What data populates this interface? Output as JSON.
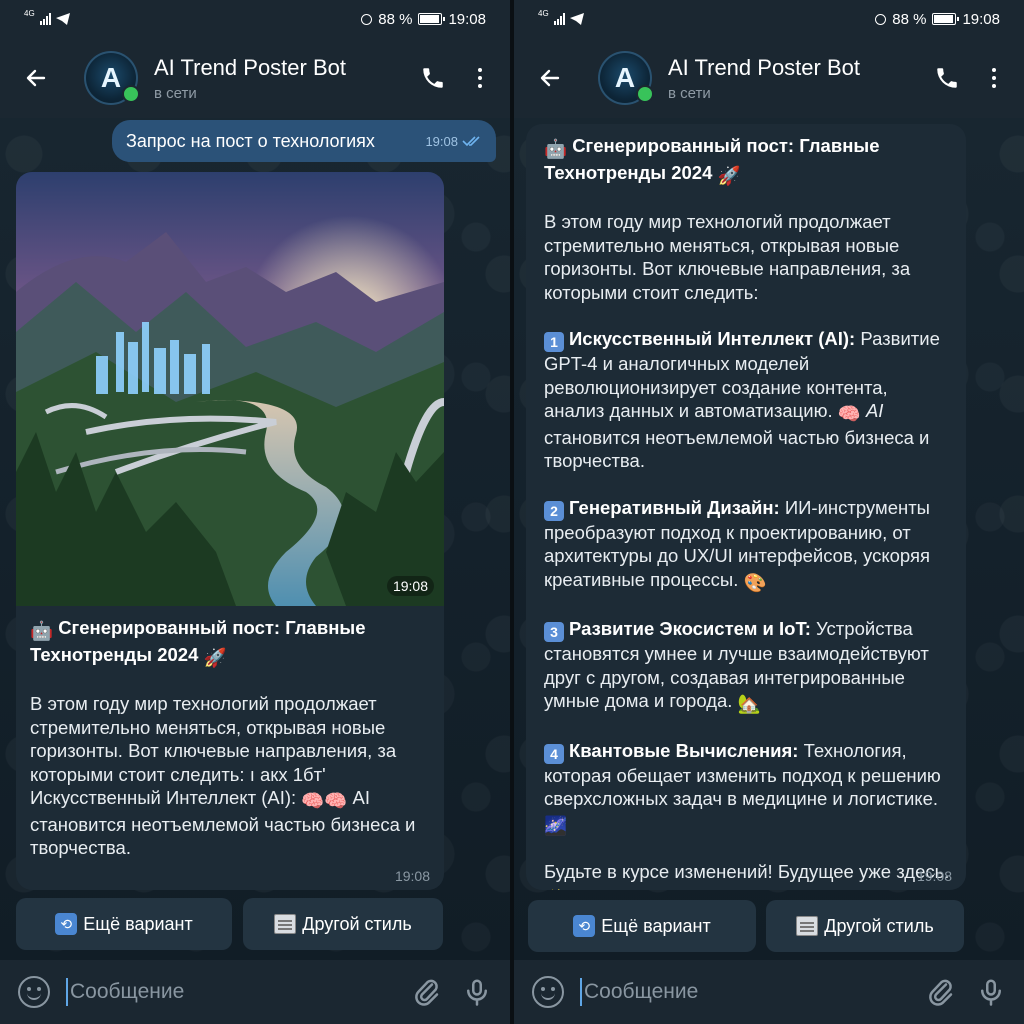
{
  "status_bar": {
    "network": "4G",
    "battery": "88 %",
    "battery_level": 0.88,
    "time": "19:08"
  },
  "header": {
    "title": "AI Trend Poster Bot",
    "status": "в сети",
    "avatar_letter": "A"
  },
  "left": {
    "outgoing": {
      "text": "Запрос на пост о технологиях",
      "time": "19:08"
    },
    "photo_time": "19:08",
    "post_title_line1": "Сгенерированный пост: Главные",
    "post_title_line2": "Технотренды 2024",
    "body": "В этом году мир технологий продолжает стремительно меняться, открывая новые горизонты. Вот ключевые направления, за которыми стоит следить: ı акх 1бт' Искусственный Интеллект (AI):",
    "body_tail": "AI становится неотъемлемой частью бизнеса и творчества.",
    "time": "19:08"
  },
  "right": {
    "post_title_line1": "Сгенерированный пост: Главные",
    "post_title_line2": "Технотренды 2024",
    "intro": "В этом году мир технологий продолжает стремительно меняться, открывая новые горизонты. Вот ключевые направления, за которыми стоит следить:",
    "items": [
      {
        "num": "1",
        "title": "Искусственный Интеллект (AI):",
        "text": "Развитие GPT-4 и аналогичных моделей революционизирует создание контента, анализ данных и автоматизацию.",
        "tail_italic": "AI",
        "tail": "становится неотъемлемой частью бизнеса и творчества."
      },
      {
        "num": "2",
        "title": "Генеративный Дизайн:",
        "text": "ИИ-инструменты преобразуют подход к проектированию, от архитектуры до UX/UI интерфейсов, ускоряя креативные процессы."
      },
      {
        "num": "3",
        "title": "Развитие Экосистем и IoT:",
        "text": "Устройства становятся умнее и лучше взаимодействуют друг с другом, создавая интегрированные умные дома и города."
      },
      {
        "num": "4",
        "title": "Квантовые Вычисления:",
        "text": "Технология, которая обещает изменить подход к решению сверхсложных задач в медицине и логистике."
      }
    ],
    "outro": "Будьте в курсе изменений! Будущее уже здесь.",
    "time": "19:08"
  },
  "buttons": {
    "another_variant": "Ещё вариант",
    "another_style": "Другой стиль"
  },
  "composer": {
    "placeholder": "Сообщение"
  },
  "colors": {
    "outgoing_bubble": "#2b5278",
    "incoming_bubble": "#1d2b36",
    "header": "#1b2731",
    "online": "#38c35a",
    "accent": "#5fa6e6"
  },
  "icons": [
    "back-arrow-icon",
    "phone-icon",
    "more-vertical-icon",
    "robot-icon",
    "rocket-icon",
    "brain-icon",
    "palette-icon",
    "house-icon",
    "galaxy-icon",
    "sparkles-icon",
    "refresh-icon",
    "newspaper-icon",
    "smile-icon",
    "paperclip-icon",
    "microphone-icon",
    "double-check-icon"
  ]
}
